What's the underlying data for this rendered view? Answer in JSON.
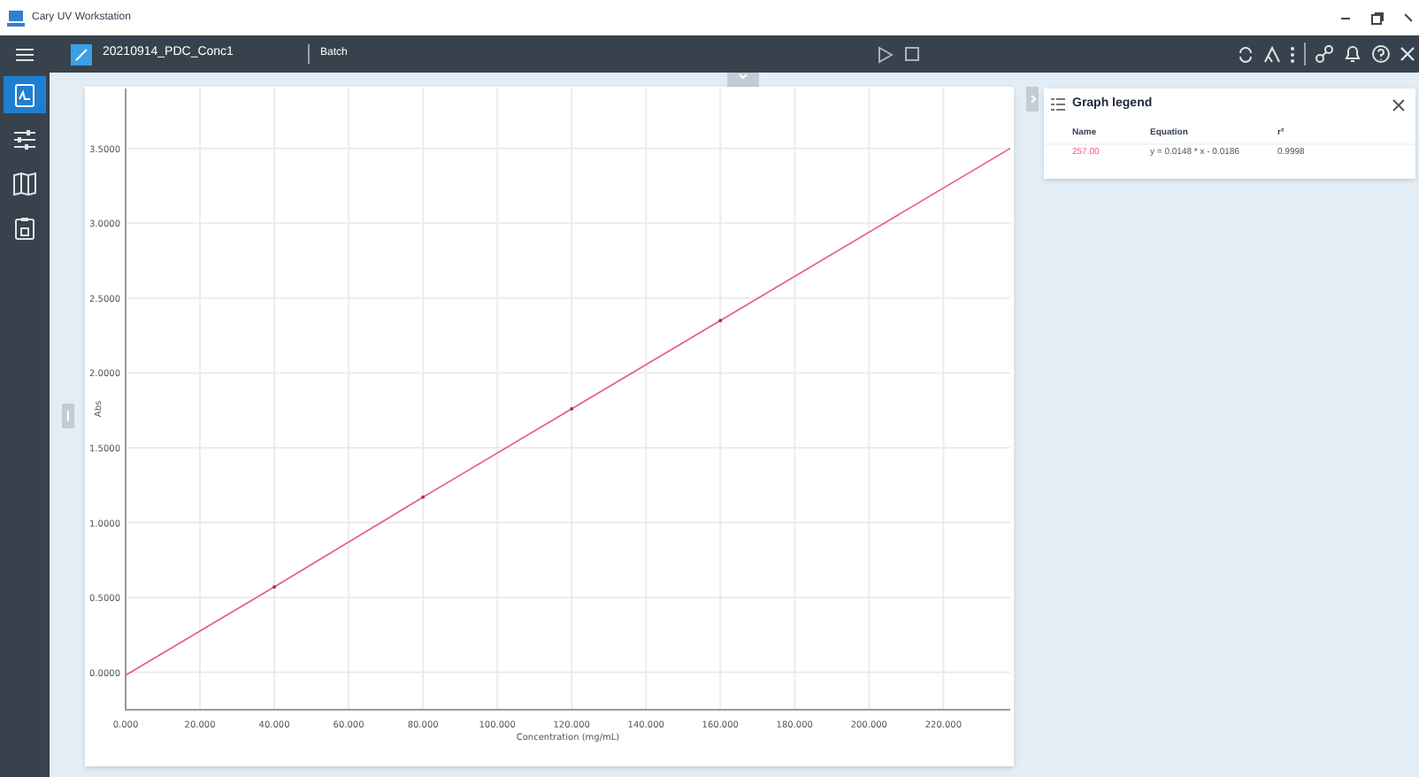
{
  "window": {
    "title": "Cary UV Workstation"
  },
  "header": {
    "document": "20210914_PDC_Conc1",
    "mode": "Batch"
  },
  "sidebar": {
    "items": [
      {
        "kind": "graph",
        "selected": true
      },
      {
        "kind": "settings",
        "selected": false
      },
      {
        "kind": "map",
        "selected": false
      },
      {
        "kind": "report",
        "selected": false
      }
    ]
  },
  "chart": {
    "chart_data": {
      "type": "line",
      "xlabel": "Concentration (mg/mL)",
      "ylabel": "Abs",
      "x": [
        0,
        40,
        80,
        120,
        160,
        238
      ],
      "series": [
        {
          "name": "257.00",
          "color": "#e8559a",
          "values": [
            -0.02,
            0.57,
            1.17,
            1.76,
            2.35,
            3.5
          ]
        }
      ],
      "xlim": [
        0,
        238
      ],
      "ylim": [
        -0.25,
        3.9
      ],
      "grid": true,
      "xticks": [
        {
          "value": 0,
          "label": "0.000"
        },
        {
          "value": 20,
          "label": "20.000"
        },
        {
          "value": 40,
          "label": "40.000"
        },
        {
          "value": 60,
          "label": "60.000"
        },
        {
          "value": 80,
          "label": "80.000"
        },
        {
          "value": 100,
          "label": "100.000"
        },
        {
          "value": 120,
          "label": "120.000"
        },
        {
          "value": 140,
          "label": "140.000"
        },
        {
          "value": 160,
          "label": "160.000"
        },
        {
          "value": 180,
          "label": "180.000"
        },
        {
          "value": 200,
          "label": "200.000"
        },
        {
          "value": 220,
          "label": "220.000"
        }
      ],
      "yticks": [
        {
          "value": 0,
          "label": "0.0000"
        },
        {
          "value": 0.5,
          "label": "0.5000"
        },
        {
          "value": 1,
          "label": "1.0000"
        },
        {
          "value": 1.5,
          "label": "1.5000"
        },
        {
          "value": 2,
          "label": "2.0000"
        },
        {
          "value": 2.5,
          "label": "2.5000"
        },
        {
          "value": 3,
          "label": "3.0000"
        },
        {
          "value": 3.5,
          "label": "3.5000"
        }
      ]
    }
  },
  "legend": {
    "title": "Graph legend",
    "columns": [
      "Name",
      "Equation",
      "r²"
    ],
    "rows": [
      {
        "equation": "y = 0.0148 * x - 0.0186",
        "r2": "0.9998"
      }
    ]
  }
}
